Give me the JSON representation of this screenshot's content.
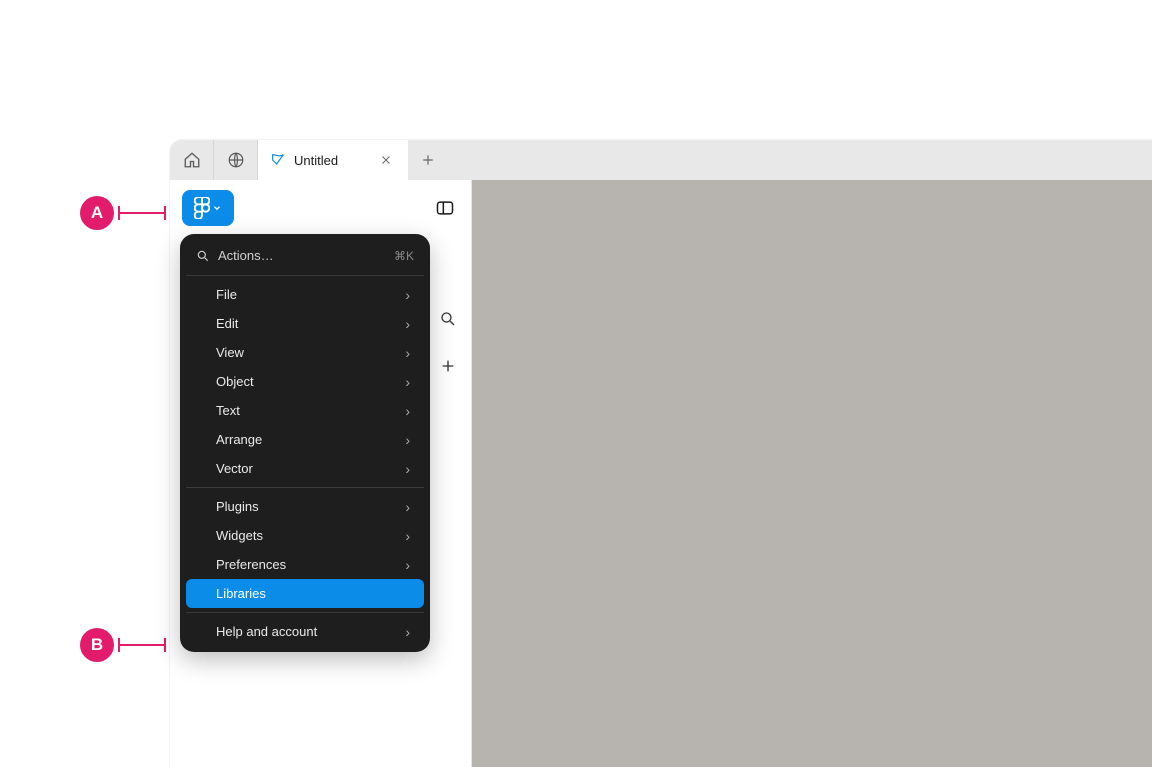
{
  "annotations": {
    "a": "A",
    "b": "B"
  },
  "tabs": {
    "active_title": "Untitled"
  },
  "menu": {
    "search_placeholder": "Actions…",
    "search_shortcut": "⌘K",
    "section1": [
      {
        "label": "File",
        "submenu": true
      },
      {
        "label": "Edit",
        "submenu": true
      },
      {
        "label": "View",
        "submenu": true
      },
      {
        "label": "Object",
        "submenu": true
      },
      {
        "label": "Text",
        "submenu": true
      },
      {
        "label": "Arrange",
        "submenu": true
      },
      {
        "label": "Vector",
        "submenu": true
      }
    ],
    "section2": [
      {
        "label": "Plugins",
        "submenu": true
      },
      {
        "label": "Widgets",
        "submenu": true
      },
      {
        "label": "Preferences",
        "submenu": true
      },
      {
        "label": "Libraries",
        "submenu": false,
        "highlighted": true
      }
    ],
    "section3": [
      {
        "label": "Help and account",
        "submenu": true
      }
    ]
  }
}
